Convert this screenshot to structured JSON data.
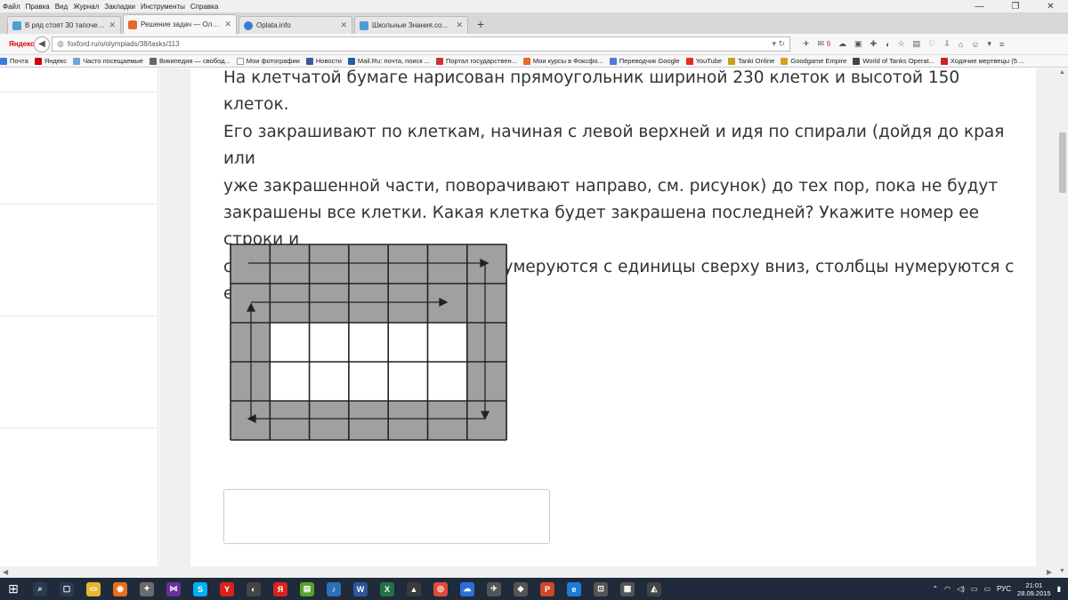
{
  "menu": [
    "Файл",
    "Правка",
    "Вид",
    "Журнал",
    "Закладки",
    "Инструменты",
    "Справка"
  ],
  "tabs": [
    {
      "label": "В ряд стоят 30 тапочек, 1...",
      "color": "#4a9fd8"
    },
    {
      "label": "Решение задач — Олим...",
      "color": "#e86a2a",
      "active": true
    },
    {
      "label": "Oplata.info",
      "color": "#3b7bd8"
    },
    {
      "label": "Школьные Знания.com -...",
      "color": "#4a9fd8"
    }
  ],
  "nav": {
    "yandex": "Яндекс",
    "url": "foxford.ru/o/olympiads/38/tasks/113",
    "badge_count": "9"
  },
  "bookmarks": [
    {
      "label": "Почта",
      "color": "#3b7bd8"
    },
    {
      "label": "Яндекс",
      "color": "#d00000"
    },
    {
      "label": "Часто посещаемые",
      "color": "#6fa8dc"
    },
    {
      "label": "Википедия — свобод...",
      "color": "#666666"
    },
    {
      "label": "Мои фотографии",
      "color": "#ffffff"
    },
    {
      "label": "Новости",
      "color": "#3b5998"
    },
    {
      "label": "Mail.Ru: почта, поиск ...",
      "color": "#1e5fa8"
    },
    {
      "label": "Портал государствен...",
      "color": "#cc3333"
    },
    {
      "label": "Мои курсы в Фоксфо...",
      "color": "#e86a2a"
    },
    {
      "label": "Переводчик Google",
      "color": "#4a7fd8"
    },
    {
      "label": "YouTube",
      "color": "#e52d27"
    },
    {
      "label": "Tanki Online",
      "color": "#c8a020"
    },
    {
      "label": "Goodgame Empire",
      "color": "#d8a020"
    },
    {
      "label": "World of Tanks Operat...",
      "color": "#444444"
    },
    {
      "label": "Ходячие мертвецы (5 ...",
      "color": "#cc2222"
    }
  ],
  "task": {
    "lines": [
      "На клетчатой бумаге нарисован прямоугольник шириной 230 клеток и высотой 150 клеток.",
      "Его закрашивают по клеткам, начиная с левой верхней и идя по спирали (дойдя до края или",
      "уже закрашенной части, поворачивают направо, см. рисунок) до тех пор, пока не будут",
      "закрашены все клетки. Какая клетка будет закрашена последней? Укажите номер ее строки и",
      "столбца через пробел (строки нумеруются с единицы сверху вниз, столбцы нумеруются с",
      "единицы слева направо)."
    ]
  },
  "figure": {
    "rows": 5,
    "cols": 7,
    "shaded_color": "#a0a0a0",
    "unshaded_cells": [
      [
        2,
        1
      ],
      [
        2,
        2
      ],
      [
        2,
        3
      ],
      [
        2,
        4
      ],
      [
        2,
        5
      ],
      [
        3,
        1
      ],
      [
        3,
        2
      ],
      [
        3,
        3
      ],
      [
        3,
        4
      ],
      [
        3,
        5
      ]
    ]
  },
  "answer": {
    "value": ""
  },
  "taskbar": {
    "icons": [
      {
        "name": "search-icon",
        "color": "#2b3a4f",
        "glyph": "⌕"
      },
      {
        "name": "task-view-icon",
        "color": "#2b3a4f",
        "glyph": "▢"
      },
      {
        "name": "explorer-icon",
        "color": "#e8b630",
        "glyph": "▭"
      },
      {
        "name": "firefox-icon",
        "color": "#e8701a",
        "glyph": "◉"
      },
      {
        "name": "settings-icon",
        "color": "#6b6b6b",
        "glyph": "✦"
      },
      {
        "name": "vs-icon",
        "color": "#6a2f9e",
        "glyph": "⋈"
      },
      {
        "name": "skype-icon",
        "color": "#00aff0",
        "glyph": "S"
      },
      {
        "name": "yandex-browser-icon",
        "color": "#d8231c",
        "glyph": "Y"
      },
      {
        "name": "media-icon",
        "color": "#444444",
        "glyph": "◐"
      },
      {
        "name": "yandex-icon",
        "color": "#d8231c",
        "glyph": "Я"
      },
      {
        "name": "folder-icon",
        "color": "#5aa02c",
        "glyph": "▤"
      },
      {
        "name": "audio-icon",
        "color": "#2d6fb8",
        "glyph": "♪"
      },
      {
        "name": "word-icon",
        "color": "#2b579a",
        "glyph": "W"
      },
      {
        "name": "excel-icon",
        "color": "#217346",
        "glyph": "X"
      },
      {
        "name": "game-icon",
        "color": "#3a3a3a",
        "glyph": "▲"
      },
      {
        "name": "chrome-icon",
        "color": "#dd4b39",
        "glyph": "◎"
      },
      {
        "name": "onedrive-icon",
        "color": "#2b6fd8",
        "glyph": "☁"
      },
      {
        "name": "plane-icon",
        "color": "#555555",
        "glyph": "✈"
      },
      {
        "name": "shield-icon",
        "color": "#555555",
        "glyph": "◆"
      },
      {
        "name": "powerpoint-icon",
        "color": "#d24726",
        "glyph": "P"
      },
      {
        "name": "edge-icon",
        "color": "#1e7bd8",
        "glyph": "e"
      },
      {
        "name": "store-icon",
        "color": "#555555",
        "glyph": "⊡"
      },
      {
        "name": "calculator-icon",
        "color": "#555555",
        "glyph": "▦"
      },
      {
        "name": "tank-icon",
        "color": "#444444",
        "glyph": "◭"
      }
    ],
    "lang": "РУС",
    "time": "21:01",
    "date": "28.09.2015"
  }
}
